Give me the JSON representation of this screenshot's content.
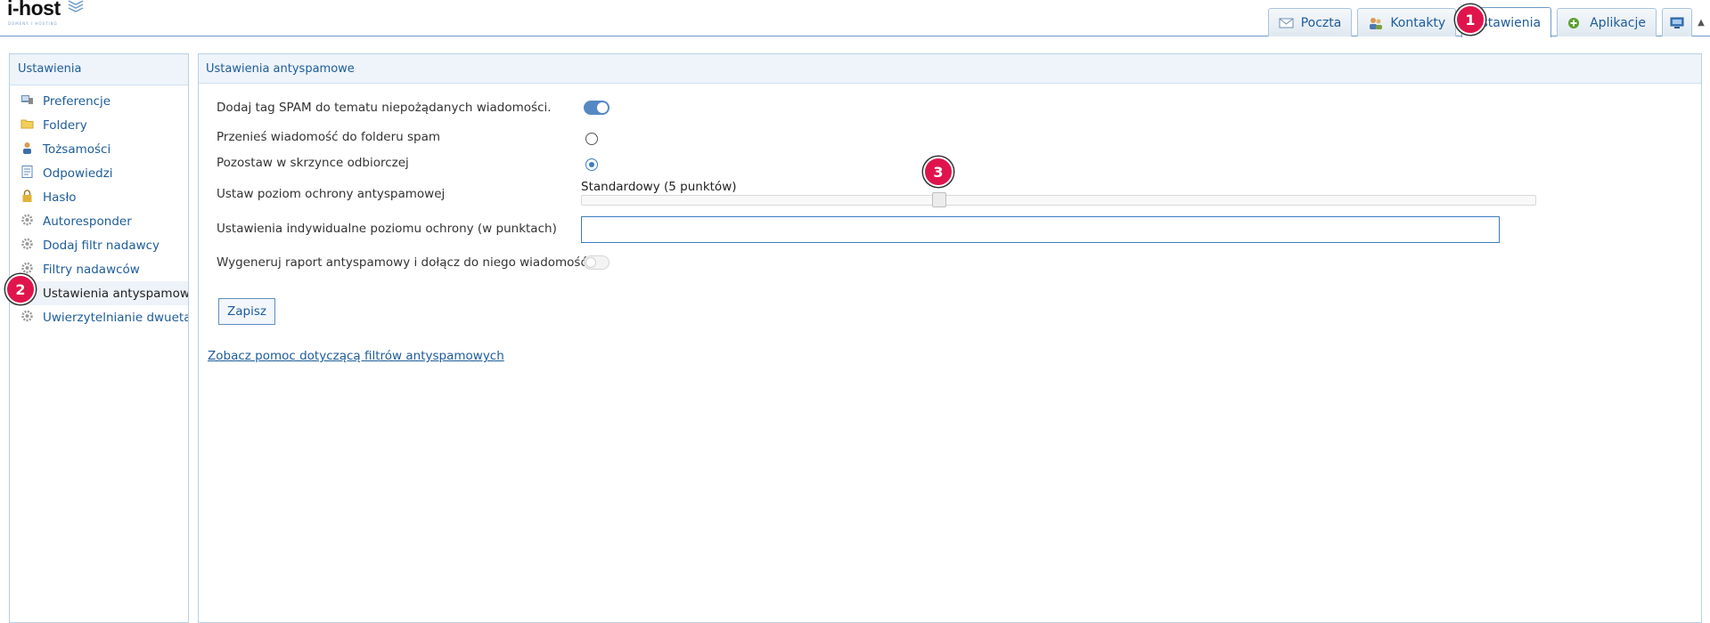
{
  "brand": {
    "name": "i-host",
    "tagline": "DOMENY I HOSTING"
  },
  "tabs": [
    {
      "label": "Poczta",
      "icon": "mail-icon"
    },
    {
      "label": "Kontakty",
      "icon": "contacts-icon"
    },
    {
      "label": "Ustawienia",
      "icon": "settings-icon",
      "active": true
    },
    {
      "label": "Aplikacje",
      "icon": "apps-plus-icon"
    }
  ],
  "sidebar": {
    "title": "Ustawienia",
    "items": [
      {
        "label": "Preferencje",
        "icon": "preferences-icon"
      },
      {
        "label": "Foldery",
        "icon": "folder-icon"
      },
      {
        "label": "Tożsamości",
        "icon": "identity-icon"
      },
      {
        "label": "Odpowiedzi",
        "icon": "document-icon"
      },
      {
        "label": "Hasło",
        "icon": "lock-icon"
      },
      {
        "label": "Autoresponder",
        "icon": "gear-icon"
      },
      {
        "label": "Dodaj filtr nadawcy",
        "icon": "gear-icon"
      },
      {
        "label": "Filtry nadawców",
        "icon": "gear-icon"
      },
      {
        "label": "Ustawienia antyspamowe",
        "icon": "gear-icon",
        "selected": true
      },
      {
        "label": "Uwierzytelnianie dwuetapowe",
        "icon": "gear-icon"
      }
    ]
  },
  "main": {
    "title": "Ustawienia antyspamowe",
    "spam_tag_label": "Dodaj tag SPAM do tematu niepożądanych wiadomości.",
    "spam_tag_on": true,
    "move_to_spam_label": "Przenieś wiadomość do folderu spam",
    "keep_in_inbox_label": "Pozostaw w skrzynce odbiorczej",
    "selected_delivery": "keep_in_inbox",
    "protection_level_label": "Ustaw poziom ochrony antyspamowej",
    "protection_level_value": "Standardowy (5 punktów)",
    "protection_level_fraction": 0.375,
    "individual_level_label": "Ustawienia indywidualne poziomu ochrony (w punktach)",
    "individual_level_value": "",
    "report_label": "Wygeneruj raport antyspamowy i dołącz do niego wiadomość.",
    "report_on": false,
    "save_label": "Zapisz",
    "help_link": "Zobacz pomoc dotyczącą filtrów antyspamowych"
  },
  "annotations": [
    "1",
    "2",
    "3"
  ],
  "colors": {
    "accent": "#1d5c9a",
    "toggle_on": "#5589c4",
    "badge": "#e0144c"
  }
}
